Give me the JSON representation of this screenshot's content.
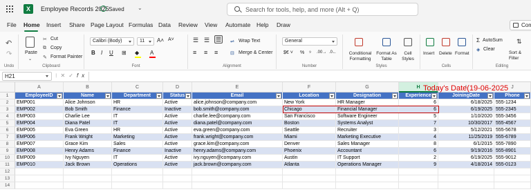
{
  "titlebar": {
    "file_title": "Employee Records 2025",
    "saved_label": "Saved",
    "search_placeholder": "Search for tools, help, and more (Alt + Q)",
    "logo_letter": "X"
  },
  "menu": {
    "items": [
      "File",
      "Home",
      "Insert",
      "Share",
      "Page Layout",
      "Formulas",
      "Data",
      "Review",
      "View",
      "Automate",
      "Help",
      "Draw"
    ],
    "active": "Home",
    "comments_label": "Comments"
  },
  "ribbon": {
    "undo_group": "Undo",
    "clipboard": {
      "paste": "Paste",
      "cut": "Cut",
      "copy": "Copy",
      "format_painter": "Format Painter",
      "group": "Clipboard"
    },
    "font": {
      "name": "Calibri (Body)",
      "size": "11",
      "group": "Font"
    },
    "alignment": {
      "wrap_text": "Wrap Text",
      "merge_center": "Merge & Center",
      "group": "Alignment"
    },
    "number": {
      "format": "General",
      "group": "Number"
    },
    "styles": {
      "conditional": "Conditional Formatting",
      "format_as_table": "Format As Table",
      "cell_styles": "Cell Styles",
      "group": "Styles"
    },
    "cells": {
      "insert": "Insert",
      "delete": "Delete",
      "format": "Format",
      "group": "Cells"
    },
    "editing": {
      "autosum": "AutoSum",
      "clear": "Clear",
      "sort_filter": "Sort & Filter",
      "group": "Editing"
    }
  },
  "formula_bar": {
    "name_box": "H21",
    "formula": ""
  },
  "columns": [
    "A",
    "B",
    "C",
    "D",
    "E",
    "F",
    "G",
    "H",
    "I",
    "J"
  ],
  "selected_column": "H",
  "rows": [
    "1",
    "2",
    "3",
    "4",
    "5",
    "6",
    "7",
    "8",
    "9",
    "10",
    "11",
    "12",
    "13",
    "14"
  ],
  "banner": "Today's Date(19-06-2025",
  "table": {
    "headers": [
      "EmployeeID",
      "Name",
      "Department",
      "Status",
      "Email",
      "Location",
      "Designation",
      "Experience",
      "JoiningDate",
      "Phone"
    ],
    "records": [
      [
        "EMP001",
        "Alice Johnson",
        "HR",
        "Active",
        "alice.johnson@company.com",
        "New York",
        "HR Manager",
        "6",
        "6/18/2025",
        "555-1234"
      ],
      [
        "EMP002",
        "Bob Smith",
        "Finance",
        "Inactive",
        "bob.smith@company.com",
        "Chicago",
        "Financial Manager",
        "6",
        "6/19/2025",
        "555-2345"
      ],
      [
        "EMP003",
        "Charlie Lee",
        "IT",
        "Active",
        "charlie.lee@company.com",
        "San Francisco",
        "Software Engineer",
        "5",
        "1/10/2020",
        "555-3456"
      ],
      [
        "EMP004",
        "Diana Patel",
        "IT",
        "Active",
        "diana.patel@company.com",
        "Boston",
        "Systems Analyst",
        "7",
        "10/30/2017",
        "555-4567"
      ],
      [
        "EMP005",
        "Eva Green",
        "HR",
        "Active",
        "eva.green@company.com",
        "Seattle",
        "Recruiter",
        "3",
        "5/12/2021",
        "555-5678"
      ],
      [
        "EMP006",
        "Frank Wright",
        "Marketing",
        "Active",
        "frank.wright@company.com",
        "Miami",
        "Marketing Executive",
        "4",
        "11/25/2019",
        "555-6789"
      ],
      [
        "EMP007",
        "Grace Kim",
        "Sales",
        "Active",
        "grace.kim@company.com",
        "Denver",
        "Sales Manager",
        "8",
        "6/1/2015",
        "555-7890"
      ],
      [
        "EMP008",
        "Henry Adams",
        "Finance",
        "Inactive",
        "henry.adams@company.com",
        "Phoenix",
        "Accountant",
        "6",
        "9/19/2016",
        "555-8901"
      ],
      [
        "EMP009",
        "Ivy Nguyen",
        "IT",
        "Active",
        "ivy.nguyen@company.com",
        "Austin",
        "IT Support",
        "2",
        "6/19/2025",
        "555-9012"
      ],
      [
        "EMP010",
        "Jack Brown",
        "Operations",
        "Active",
        "jack.brown@company.com",
        "Atlanta",
        "Operations Manager",
        "9",
        "4/18/2014",
        "555-0123"
      ]
    ]
  },
  "colors": {
    "header_blue": "#4472c4",
    "band": "#d9e1f2",
    "excel_green": "#107c41",
    "banner_red": "#e00000"
  }
}
